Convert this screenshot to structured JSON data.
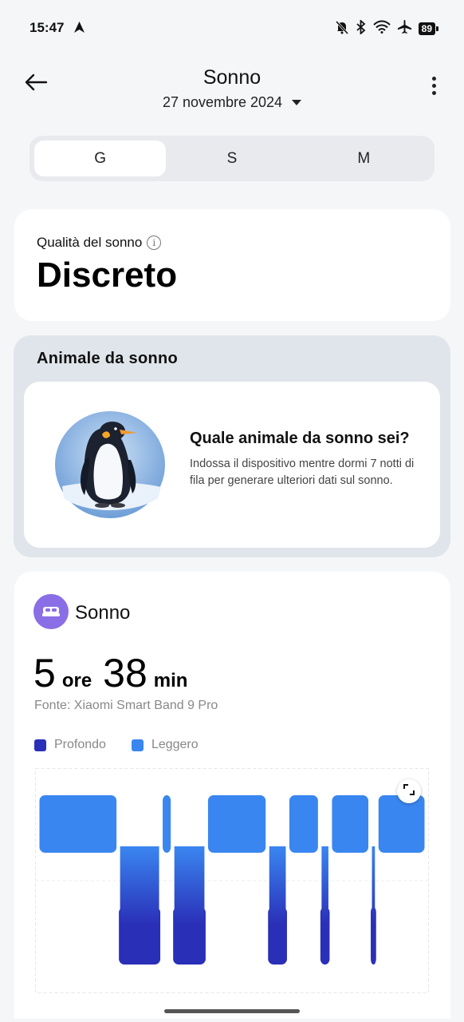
{
  "status": {
    "time": "15:47",
    "battery": "89"
  },
  "header": {
    "title": "Sonno",
    "date": "27 novembre 2024"
  },
  "tabs": [
    {
      "label": "G",
      "active": true
    },
    {
      "label": "S",
      "active": false
    },
    {
      "label": "M",
      "active": false
    }
  ],
  "quality": {
    "label": "Qualità del sonno",
    "value": "Discreto"
  },
  "animal": {
    "title": "Animale da sonno",
    "question": "Quale animale da sonno sei?",
    "description": "Indossa il dispositivo mentre dormi 7 notti di fila per generare ulteriori dati sul sonno."
  },
  "sleep": {
    "title": "Sonno",
    "hours": "5",
    "hours_unit": "ore",
    "minutes": "38",
    "minutes_unit": "min",
    "source": "Fonte: Xiaomi Smart Band 9 Pro",
    "legend": [
      {
        "name": "Profondo",
        "color": "#2a2fb8"
      },
      {
        "name": "Leggero",
        "color": "#3a86f0"
      }
    ]
  },
  "chart_data": {
    "type": "area",
    "levels": [
      "Leggero",
      "Profondo"
    ],
    "segments": [
      {
        "stage": "Leggero",
        "start": 0.0,
        "end": 0.205
      },
      {
        "stage": "Profondo",
        "start": 0.205,
        "end": 0.318
      },
      {
        "stage": "Leggero",
        "start": 0.318,
        "end": 0.345
      },
      {
        "stage": "Profondo",
        "start": 0.345,
        "end": 0.435
      },
      {
        "stage": "Leggero",
        "start": 0.435,
        "end": 0.59
      },
      {
        "stage": "Profondo",
        "start": 0.59,
        "end": 0.645
      },
      {
        "stage": "Leggero",
        "start": 0.645,
        "end": 0.725
      },
      {
        "stage": "Profondo",
        "start": 0.725,
        "end": 0.755
      },
      {
        "stage": "Leggero",
        "start": 0.755,
        "end": 0.855
      },
      {
        "stage": "Profondo",
        "start": 0.855,
        "end": 0.875
      },
      {
        "stage": "Leggero",
        "start": 0.875,
        "end": 1.0
      }
    ]
  }
}
